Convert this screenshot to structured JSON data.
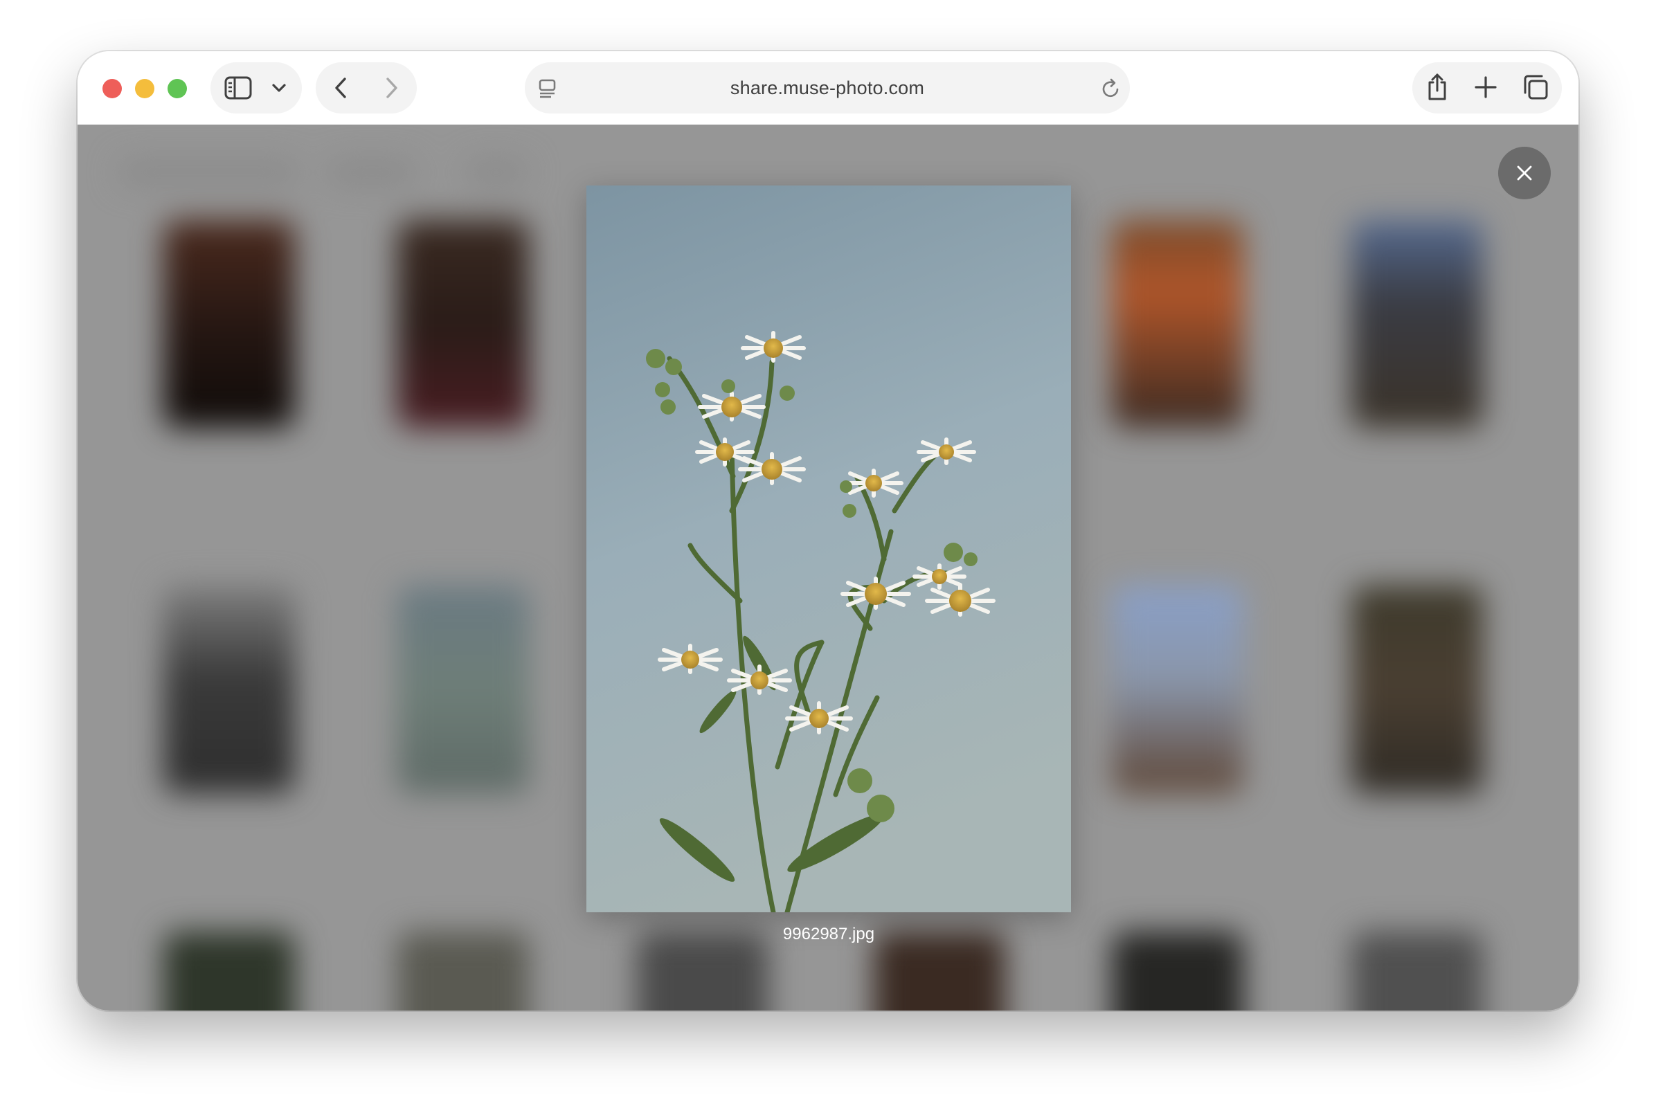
{
  "browser": {
    "url": "share.muse-photo.com",
    "toolbar_icons": [
      "sidebar-toggle-icon",
      "chevron-down-icon",
      "back-arrow-icon",
      "forward-arrow-icon",
      "page-menu-icon",
      "reload-icon",
      "share-icon",
      "new-tab-icon",
      "tab-overview-icon"
    ]
  },
  "colors": {
    "traffic_close": "#ee5e59",
    "traffic_minimize": "#f4bd3c",
    "traffic_maximize": "#5fc454",
    "overlay": "#969696"
  },
  "lightbox": {
    "filename": "9962987.jpg",
    "close_icon": "close-icon",
    "image_subject": "white fleabane daisy flowers against pale blue sky"
  }
}
